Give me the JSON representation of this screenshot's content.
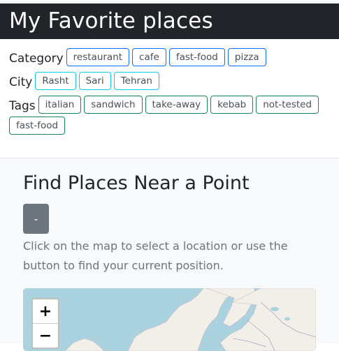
{
  "header": {
    "title": "My Favorite places"
  },
  "filters": {
    "category": {
      "label": "Category",
      "items": [
        "restaurant",
        "cafe",
        "fast-food",
        "pizza"
      ]
    },
    "city": {
      "label": "City",
      "items": [
        "Rasht",
        "Sari",
        "Tehran"
      ]
    },
    "tags": {
      "label": "Tags",
      "items": [
        "italian",
        "sandwich",
        "take-away",
        "kebab",
        "not-tested",
        "fast-food"
      ]
    }
  },
  "finder": {
    "title": "Find Places Near a Point",
    "locate_button": "-",
    "hint": "Click on the map to select a location or use the button to find your current position."
  },
  "map": {
    "zoom_in": "+",
    "zoom_out": "−"
  },
  "colors": {
    "header_bg": "#212529",
    "category_border": "#0d6efd",
    "city_border": "#0dcaf0",
    "tag_border": "#198754",
    "button_bg": "#6c757d",
    "water": "#aad3df",
    "land": "#f2efe9"
  }
}
